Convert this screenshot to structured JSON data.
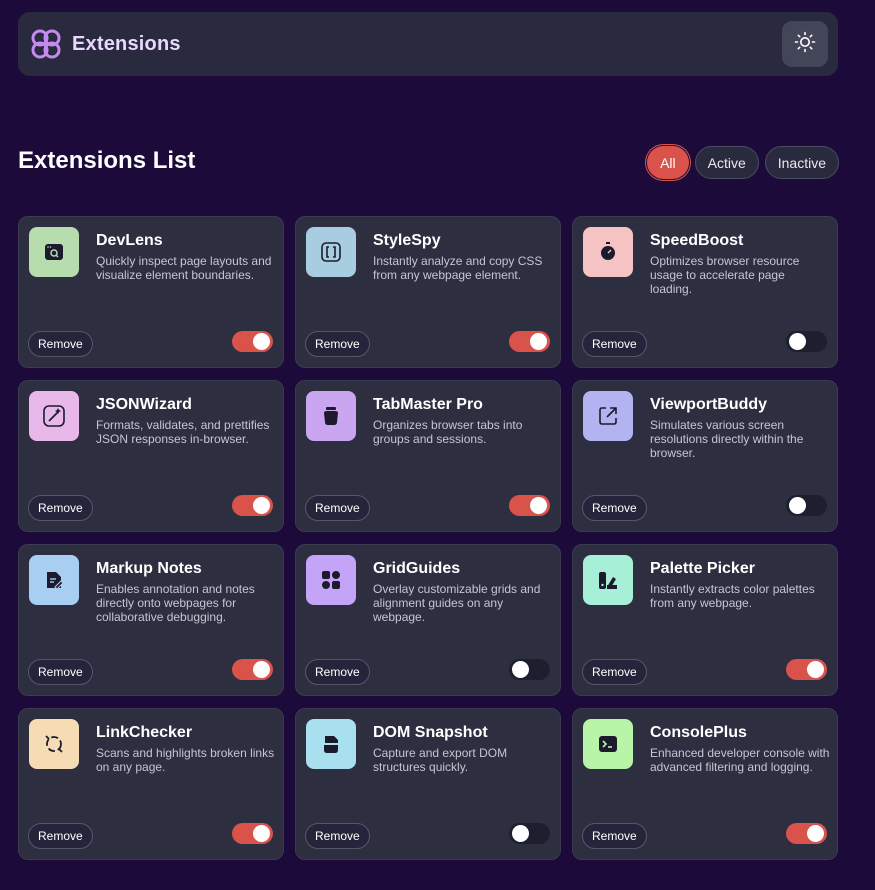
{
  "header": {
    "brand": "Extensions",
    "logo_icon": "flower-logo-icon",
    "theme_icon": "sun-icon"
  },
  "list": {
    "title": "Extensions List",
    "filters": [
      {
        "label": "All",
        "active": true
      },
      {
        "label": "Active",
        "active": false
      },
      {
        "label": "Inactive",
        "active": false
      }
    ],
    "remove_label": "Remove"
  },
  "colors": {
    "accent": "#d9534a",
    "background": "#1c0a3a",
    "card": "#2d2e40"
  },
  "extensions": [
    {
      "name": "DevLens",
      "desc": "Quickly inspect page layouts and visualize element boundaries.",
      "enabled": true,
      "icon": "browser-search-icon",
      "icon_bg": "#b7dcae"
    },
    {
      "name": "StyleSpy",
      "desc": "Instantly analyze and copy CSS from any webpage element.",
      "enabled": true,
      "icon": "brackets-icon",
      "icon_bg": "#a9cde0"
    },
    {
      "name": "SpeedBoost",
      "desc": "Optimizes browser resource usage to accelerate page loading.",
      "enabled": false,
      "icon": "stopwatch-icon",
      "icon_bg": "#f5c3c3"
    },
    {
      "name": "JSONWizard",
      "desc": "Formats, validates, and prettifies JSON responses in-browser.",
      "enabled": true,
      "icon": "wand-icon",
      "icon_bg": "#e9b8ea"
    },
    {
      "name": "TabMaster Pro",
      "desc": "Organizes browser tabs into groups and sessions.",
      "enabled": true,
      "icon": "jar-icon",
      "icon_bg": "#c9a6ef"
    },
    {
      "name": "ViewportBuddy",
      "desc": "Simulates various screen resolutions directly within the browser.",
      "enabled": false,
      "icon": "expand-icon",
      "icon_bg": "#b3b3f2"
    },
    {
      "name": "Markup Notes",
      "desc": "Enables annotation and notes directly onto webpages for collaborative debugging.",
      "enabled": true,
      "icon": "note-edit-icon",
      "icon_bg": "#a8cff2"
    },
    {
      "name": "GridGuides",
      "desc": "Overlay customizable grids and alignment guides on any webpage.",
      "enabled": false,
      "icon": "grid-icon",
      "icon_bg": "#c4a4f7"
    },
    {
      "name": "Palette Picker",
      "desc": "Instantly extracts color palettes from any webpage.",
      "enabled": true,
      "icon": "palette-icon",
      "icon_bg": "#a7efd7"
    },
    {
      "name": "LinkChecker",
      "desc": "Scans and highlights broken links on any page.",
      "enabled": true,
      "icon": "broken-link-icon",
      "icon_bg": "#f6dcb4"
    },
    {
      "name": "DOM Snapshot",
      "desc": "Capture and export DOM structures quickly.",
      "enabled": false,
      "icon": "snapshot-icon",
      "icon_bg": "#a9e0ef"
    },
    {
      "name": "ConsolePlus",
      "desc": "Enhanced developer console with advanced filtering and logging.",
      "enabled": true,
      "icon": "terminal-icon",
      "icon_bg": "#b9f5a9"
    }
  ]
}
